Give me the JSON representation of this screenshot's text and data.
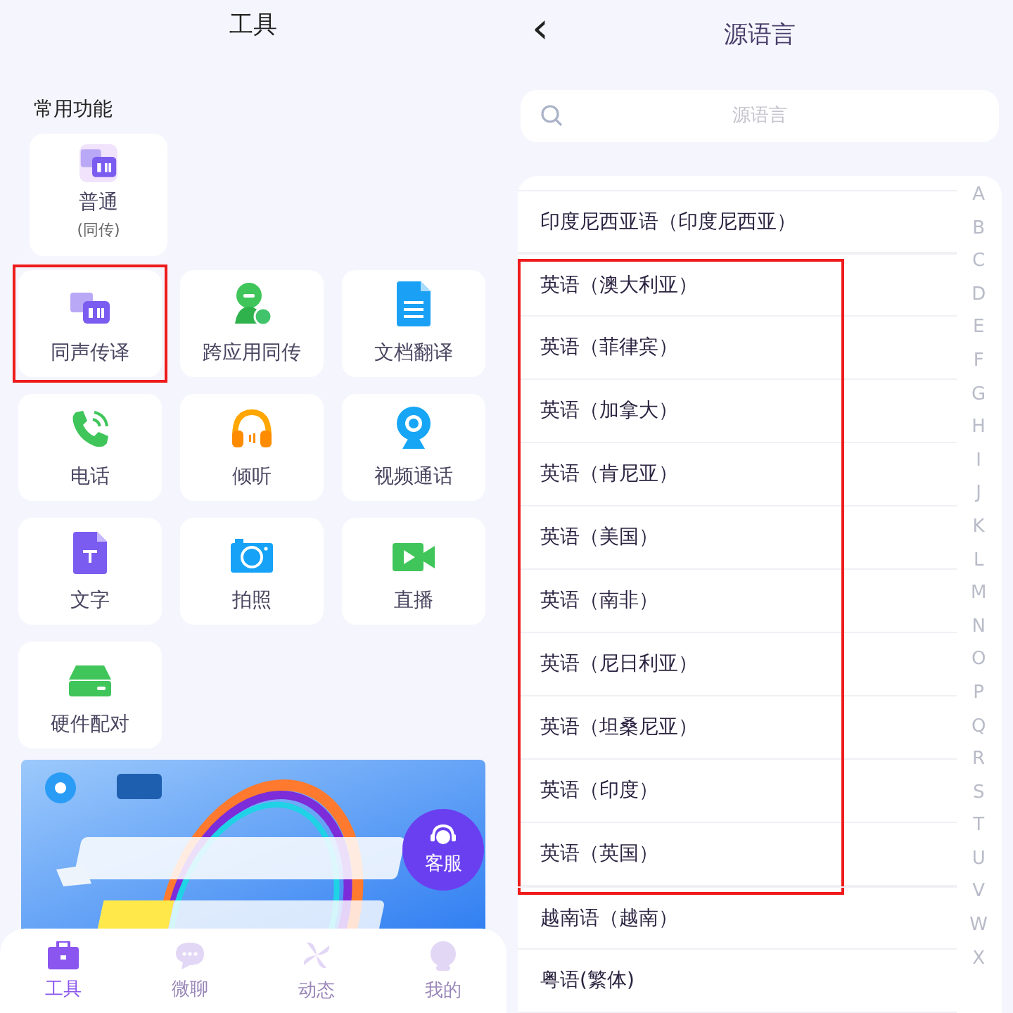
{
  "tools_screen": {
    "title": "工具",
    "section_title": "常用功能",
    "common": [
      {
        "label": "普通",
        "sublabel": "(同传)"
      }
    ],
    "tools": [
      {
        "label": "同声传译",
        "highlighted": true
      },
      {
        "label": "跨应用同传",
        "highlighted": false
      },
      {
        "label": "文档翻译",
        "highlighted": false
      },
      {
        "label": "电话",
        "highlighted": false
      },
      {
        "label": "倾听",
        "highlighted": false
      },
      {
        "label": "视频通话",
        "highlighted": false
      },
      {
        "label": "文字",
        "highlighted": false
      },
      {
        "label": "拍照",
        "highlighted": false
      },
      {
        "label": "直播",
        "highlighted": false
      },
      {
        "label": "硬件配对",
        "highlighted": false
      }
    ],
    "support_button": {
      "label": "客服"
    },
    "nav": [
      {
        "label": "工具",
        "selected": true
      },
      {
        "label": "微聊",
        "selected": false
      },
      {
        "label": "动态",
        "selected": false
      },
      {
        "label": "我的",
        "selected": false
      }
    ]
  },
  "language_screen": {
    "title": "源语言",
    "back": "‹",
    "search": {
      "placeholder": "源语言"
    },
    "language_groups": [
      {
        "highlighted": false,
        "languages": [
          "印度尼西亚语（印度尼西亚）"
        ]
      },
      {
        "highlighted": true,
        "languages": [
          "英语（澳大利亚）",
          "英语（菲律宾）",
          "英语（加拿大）",
          "英语（肯尼亚）",
          "英语（美国）",
          "英语（南非）",
          "英语（尼日利亚）",
          "英语（坦桑尼亚）",
          "英语（印度）",
          "英语（英国）"
        ]
      },
      {
        "highlighted": false,
        "languages": [
          "越南语（越南）",
          "粤语(繁体)"
        ]
      }
    ],
    "index_letters": [
      "A",
      "B",
      "C",
      "D",
      "E",
      "F",
      "G",
      "H",
      "I",
      "J",
      "K",
      "L",
      "M",
      "N",
      "O",
      "P",
      "Q",
      "R",
      "S",
      "T",
      "U",
      "V",
      "W",
      "X"
    ]
  }
}
